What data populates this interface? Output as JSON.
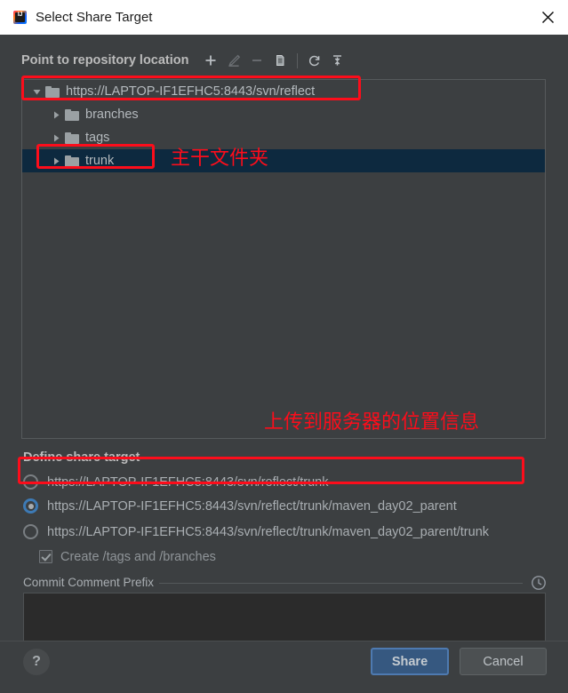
{
  "window": {
    "title": "Select Share Target",
    "icon": "intellij-idea-icon",
    "close_icon": "close-icon"
  },
  "repository": {
    "label": "Point to repository location",
    "toolbar": [
      {
        "name": "add-repository-button",
        "icon": "plus-icon",
        "enabled": true
      },
      {
        "name": "edit-repository-button",
        "icon": "pencil-icon",
        "enabled": false
      },
      {
        "name": "remove-repository-button",
        "icon": "minus-icon",
        "enabled": false
      },
      {
        "name": "copy-repository-button",
        "icon": "document-copy-icon",
        "enabled": true
      },
      {
        "name": "refresh-button",
        "icon": "refresh-icon",
        "enabled": true
      },
      {
        "name": "collapse-all-button",
        "icon": "collapse-all-icon",
        "enabled": true
      }
    ]
  },
  "tree": {
    "nodes": [
      {
        "label": "https://LAPTOP-IF1EFHC5:8443/svn/reflect",
        "depth": 0,
        "expanded": true,
        "selected": false,
        "icon": "folder-icon",
        "arrow": "chevron-down-icon"
      },
      {
        "label": "branches",
        "depth": 1,
        "expanded": false,
        "selected": false,
        "icon": "folder-icon",
        "arrow": "chevron-right-icon"
      },
      {
        "label": "tags",
        "depth": 1,
        "expanded": false,
        "selected": false,
        "icon": "folder-icon",
        "arrow": "chevron-right-icon"
      },
      {
        "label": "trunk",
        "depth": 1,
        "expanded": false,
        "selected": true,
        "icon": "folder-icon",
        "arrow": "chevron-right-icon"
      }
    ]
  },
  "share_target": {
    "label": "Define share target",
    "options": [
      {
        "label": "https://LAPTOP-IF1EFHC5:8443/svn/reflect/trunk",
        "selected": false
      },
      {
        "label": "https://LAPTOP-IF1EFHC5:8443/svn/reflect/trunk/maven_day02_parent",
        "selected": true
      },
      {
        "label": "https://LAPTOP-IF1EFHC5:8443/svn/reflect/trunk/maven_day02_parent/trunk",
        "selected": false
      }
    ],
    "checkbox": {
      "label": "Create /tags and /branches",
      "checked": true,
      "enabled": false
    }
  },
  "commit_comment_prefix": {
    "label": "Commit Comment Prefix",
    "history_icon": "clock-icon",
    "value": ""
  },
  "footer": {
    "help_label": "?",
    "share_label": "Share",
    "cancel_label": "Cancel"
  },
  "annotations": {
    "trunk_note": "主干文件夹",
    "target_note": "上传到服务器的位置信息",
    "color": "#fc0d1b"
  },
  "colors": {
    "dialog_bg": "#3c3f41",
    "titlebar_bg": "#ffffff",
    "tree_selection": "#0d293f",
    "primary_button": "#365880",
    "accent_radio": "#3d7ab5",
    "text": "#b4b9bd"
  }
}
